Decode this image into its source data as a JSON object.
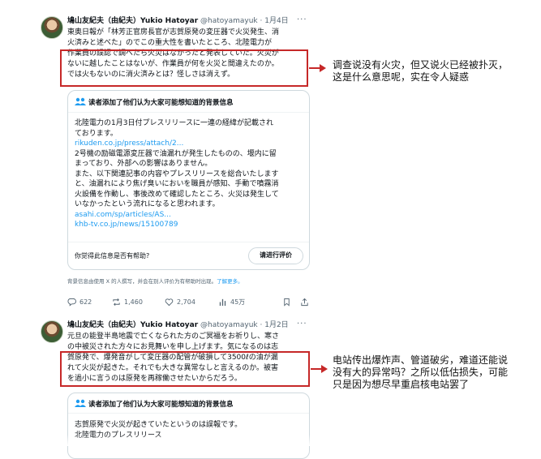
{
  "tweet1": {
    "name": "鳩山友紀夫（由紀夫）Yukio Hatoyar",
    "handle_time": "@hatoyamayuk · 1月4日",
    "more": "···",
    "lines": [
      "東奥日報が「林芳正官房長官が志賀原発の変圧器で火災発生、消",
      "火済みと述べた」のでこの重大性を書いたところ、北陸電力が",
      "作業員の誤認で調べたら火災はなかったと発表していた。火災が",
      "ないに越したことはないが、作業員が何を火災と間違えたのか。",
      "では火もないのに消火済みとは？怪しさは消えず。"
    ],
    "note": {
      "header": "读者添加了他们认为大家可能想知道的背景信息",
      "lines": [
        "北陸電力の1月3日付プレスリリースに一連の経緯が記載され",
        "ております。",
        "rikuden.co.jp/press/attach/2...",
        "2号機の励磁電源変圧器で油漏れが発生したものの、堰内に留",
        "まっており、外部への影響はありません。",
        "また、以下関連記事の内容やプレスリリースを総合いたします",
        "と、油漏れにより焦げ臭いにおいを職員が感知、手動で噴霧消",
        "火設備を作動し、事後改めて確認したところ、火災は発生して",
        "いなかったという流れになると思われます。",
        "asahi.com/sp/articles/AS...",
        "khb-tv.co.jp/news/15100789"
      ],
      "helpful_question": "你觉得此信息是否有帮助?",
      "rate_button": "请进行评价"
    },
    "disclaimer": "背景信息由使用 X 的人撰写，并会在别人评价为有帮助时出现。",
    "learn_more": "了解更多。",
    "replies": "622",
    "reposts": "1,460",
    "likes": "2,704",
    "views": "45万"
  },
  "annotation1": [
    "调查说没有火灾，但又说火已经被扑灭，",
    "这是什么意思呢，实在令人疑惑"
  ],
  "tweet2": {
    "name": "鳩山友紀夫（由紀夫）Yukio Hatoyar",
    "handle_time": "@hatoyamayuk · 1月2日",
    "more": "···",
    "lines": [
      "元旦の能登半島地震で亡くなられた方のご冥福をお祈りし、寒さ",
      "の中被災された方々にお見舞いを申し上げます。気になるのは志",
      "賀原発で、爆発音がして変圧器の配管が破損して3500ℓの油が漏",
      "れて火災が起きた。それでも大きな異常なしと言えるのか。被害",
      "を過小に言うのは原発を再稼働させたいからだろう。"
    ],
    "note": {
      "header": "读者添加了他们认为大家可能想知道的背景信息",
      "lines": [
        "志賀原発で火災が起きていたというのは誤報です。",
        "北陸電力のプレスリリース"
      ]
    }
  },
  "annotation2": [
    "电站传出爆炸声、管道破劣，难道还能说",
    "没有大的异常吗？之所以低估损失，可能",
    "只是因为想尽早重启核电站罢了"
  ],
  "colors": {
    "accent": "#1d9bf0",
    "highlight": "#c62828",
    "text": "#0f1419",
    "muted": "#536471"
  }
}
